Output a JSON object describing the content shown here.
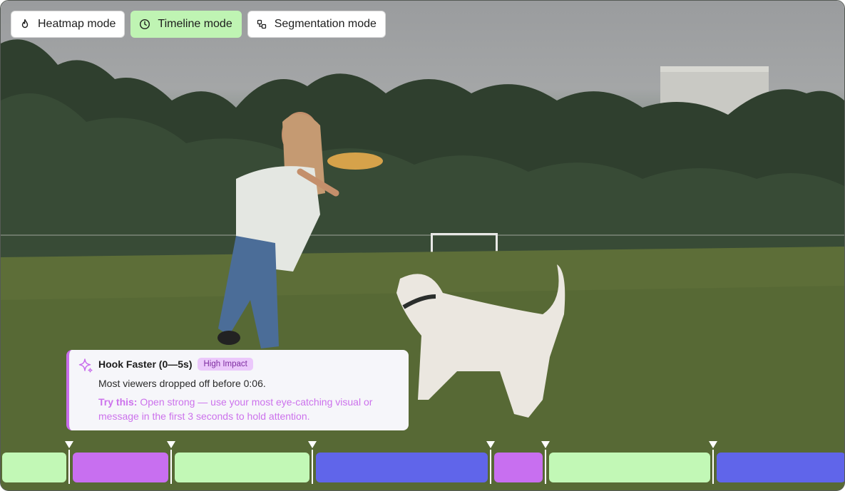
{
  "toolbar": {
    "modes": [
      {
        "label": "Heatmap mode",
        "icon": "flame-icon",
        "active": false
      },
      {
        "label": "Timeline mode",
        "icon": "clock-icon",
        "active": true
      },
      {
        "label": "Segmentation mode",
        "icon": "segments-icon",
        "active": false
      }
    ]
  },
  "insight": {
    "title": "Hook Faster (0—5s)",
    "badge": "High Impact",
    "description": "Most viewers dropped off before 0:06.",
    "tip_label": "Try this:",
    "tip_text": " Open strong — use your most eye-catching visual or message in the first 3 seconds to hold attention.",
    "icon": "sparkle-icon"
  },
  "timeline": {
    "segments": [
      {
        "kind": "good",
        "color": "#c2f8b6"
      },
      {
        "kind": "drop",
        "color": "#c86ff0"
      },
      {
        "kind": "good",
        "color": "#c2f8b6"
      },
      {
        "kind": "neutral",
        "color": "#6065ea"
      },
      {
        "kind": "drop",
        "color": "#c86ff0"
      },
      {
        "kind": "good",
        "color": "#c2f8b6"
      },
      {
        "kind": "neutral",
        "color": "#6065ea"
      }
    ]
  },
  "colors": {
    "active_mode": "#bff4b3",
    "accent_purple": "#c86dec",
    "badge_bg": "#ebc8fb"
  }
}
